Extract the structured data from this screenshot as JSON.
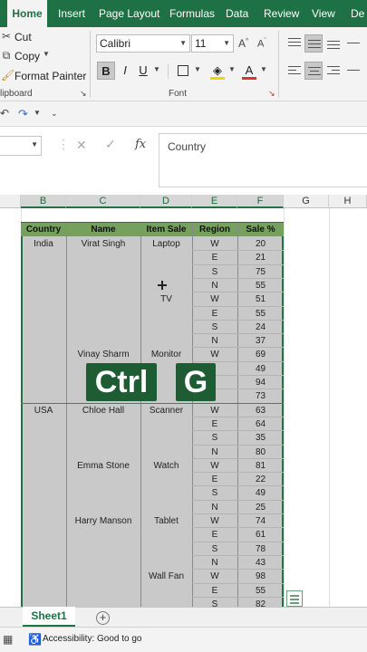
{
  "ribbon": {
    "tabs": [
      "Home",
      "Insert",
      "Page Layout",
      "Formulas",
      "Data",
      "Review",
      "View",
      "De"
    ],
    "clipboard": {
      "cut": "Cut",
      "copy": "Copy",
      "format_painter": "Format Painter",
      "label": "lipboard"
    },
    "font": {
      "name": "Calibri",
      "size": "11",
      "label": "Font",
      "bold": "B",
      "italic": "I",
      "underline": "U"
    }
  },
  "formula_bar": {
    "fx": "fx",
    "value": "Country"
  },
  "columns": [
    "B",
    "C",
    "D",
    "E",
    "F",
    "G",
    "H"
  ],
  "table": {
    "headers": [
      "Country",
      "Name",
      "Item Sale",
      "Region",
      "Sale %"
    ],
    "country": [
      {
        "row": 0,
        "text": "India"
      },
      {
        "row": 12,
        "text": "USA"
      }
    ],
    "names": [
      {
        "row": 0,
        "text": "Virat Singh"
      },
      {
        "row": 8,
        "text": "Vinay Sharm"
      },
      {
        "row": 12,
        "text": "Chloe Hall"
      },
      {
        "row": 16,
        "text": "Emma Stone"
      },
      {
        "row": 20,
        "text": "Harry Manson"
      }
    ],
    "items": [
      {
        "row": 0,
        "text": "Laptop"
      },
      {
        "row": 4,
        "text": "TV"
      },
      {
        "row": 8,
        "text": "Monitor"
      },
      {
        "row": 12,
        "text": "Scanner"
      },
      {
        "row": 16,
        "text": "Watch"
      },
      {
        "row": 20,
        "text": "Tablet"
      },
      {
        "row": 24,
        "text": "Wall Fan"
      }
    ],
    "regions": [
      "W",
      "E",
      "S",
      "N",
      "W",
      "E",
      "S",
      "N",
      "W",
      "",
      "",
      "",
      "W",
      "E",
      "S",
      "N",
      "W",
      "E",
      "S",
      "N",
      "W",
      "E",
      "S",
      "N",
      "W",
      "E",
      "S"
    ],
    "sales": [
      "20",
      "21",
      "75",
      "55",
      "51",
      "55",
      "24",
      "37",
      "69",
      "49",
      "94",
      "73",
      "63",
      "64",
      "35",
      "80",
      "81",
      "22",
      "49",
      "25",
      "74",
      "61",
      "78",
      "43",
      "98",
      "55",
      "82"
    ]
  },
  "overlay_keys": [
    "Ctrl",
    "G"
  ],
  "sheet_tab": "Sheet1",
  "status": {
    "accessibility": "Accessibility: Good to go"
  }
}
